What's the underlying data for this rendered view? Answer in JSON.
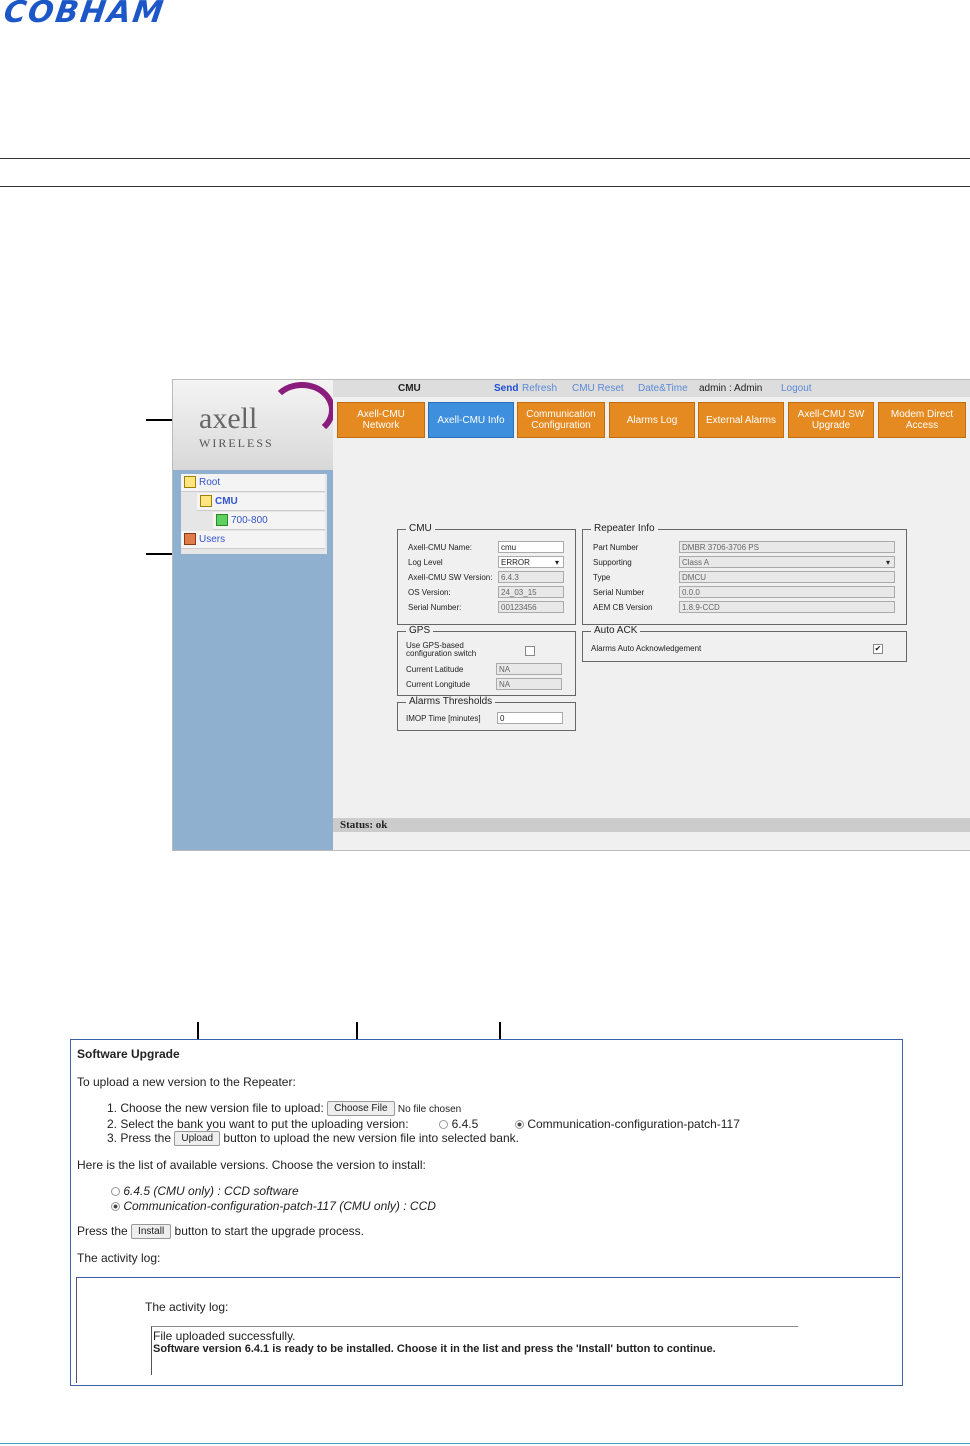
{
  "header": {
    "brand": "COBHAM"
  },
  "app": {
    "sidebar": {
      "brand_name": "axell",
      "brand_sub": "WIRELESS",
      "tree": [
        "Root",
        "CMU",
        "700-800",
        "Users"
      ]
    },
    "topbar": {
      "title": "CMU",
      "send": "Send",
      "refresh": "Refresh",
      "cmu_reset": "CMU Reset",
      "datetime": "Date&Time",
      "user": "admin : Admin",
      "logout": "Logout"
    },
    "tabs": [
      "Axell-CMU Network",
      "Axell-CMU Info",
      "Communication Configuration",
      "Alarms Log",
      "External Alarms",
      "Axell-CMU SW Upgrade",
      "Modem Direct Access"
    ],
    "cmu": {
      "legend": "CMU",
      "rows": [
        {
          "label": "Axell-CMU Name:",
          "value": "cmu"
        },
        {
          "label": "Log Level",
          "value": "ERROR"
        },
        {
          "label": "Axell-CMU SW Version:",
          "value": "6.4.3"
        },
        {
          "label": "OS Version:",
          "value": "24_03_15"
        },
        {
          "label": "Serial Number:",
          "value": "00123456"
        }
      ]
    },
    "repeater": {
      "legend": "Repeater Info",
      "rows": [
        {
          "label": "Part Number",
          "value": "DMBR 3706-3706 PS"
        },
        {
          "label": "Supporting",
          "value": "Class A"
        },
        {
          "label": "Type",
          "value": "DMCU"
        },
        {
          "label": "Serial Number",
          "value": "0.0.0"
        },
        {
          "label": "AEM CB Version",
          "value": "1.8.9-CCD"
        }
      ]
    },
    "gps": {
      "legend": "GPS",
      "switch_label": "Use GPS-based configuration switch",
      "lat_label": "Current Latitude",
      "lat_value": "NA",
      "lon_label": "Current Longitude",
      "lon_value": "NA"
    },
    "auto_ack": {
      "legend": "Auto ACK",
      "label": "Alarms Auto Acknowledgement"
    },
    "thresholds": {
      "legend": "Alarms Thresholds",
      "label": "IMOP Time [minutes]",
      "value": "0"
    },
    "status": "Status: ok"
  },
  "upgrade": {
    "title": "Software Upgrade",
    "intro": "To upload a new version to the Repeater:",
    "step1": "1. Choose the new version file to upload:",
    "choose_file": "Choose File",
    "no_file": "No file chosen",
    "step2": "2. Select the bank you want to put the uploading version:",
    "bank1": "6.4.5",
    "bank2": "Communication-configuration-patch-117",
    "step3_pre": "3. Press the",
    "upload": "Upload",
    "step3_post": "button to upload the new version file into selected bank.",
    "list_intro": "Here is the list of available versions. Choose the version to install:",
    "version1": "6.4.5 (CMU only) : CCD software",
    "version2": "Communication-configuration-patch-117 (CMU only) : CCD",
    "press_pre": "Press the",
    "install": "Install",
    "press_post": "button to start the upgrade process.",
    "activity_label": "The activity log:",
    "log_title": "The activity log:",
    "log_line1": "File uploaded successfully.",
    "log_line2": "Software version 6.4.1 is ready to be installed. Choose it in the list and press the 'Install' button to continue."
  }
}
